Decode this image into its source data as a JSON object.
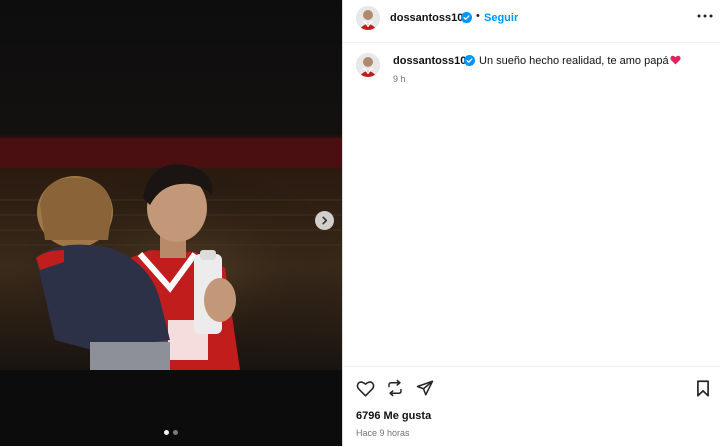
{
  "post": {
    "username": "dossantoss10_",
    "separator": "•",
    "follow_label": "Seguir",
    "caption": "Un sueño hecho realidad, te amo papá",
    "caption_emoji": "red-heart",
    "relative_time": "9 h",
    "likes": "6796 Me gusta",
    "posted_ago": "Hace 9 horas"
  },
  "media": {
    "photo_subject": "player-holding-child",
    "slide_count": 2,
    "active_slide": 1
  },
  "icons": {
    "avatar": "avatar-icon",
    "verified": "verified-badge-icon",
    "more": "more-options-icon",
    "next": "chevron-right-icon",
    "like": "heart-icon",
    "repost": "repost-icon",
    "share": "share-icon",
    "save": "bookmark-icon"
  },
  "colors": {
    "accent": "#0095f6",
    "verified": "#0095f6",
    "jersey_red": "#c21d1d",
    "emoji_heart": "#e0245e"
  }
}
